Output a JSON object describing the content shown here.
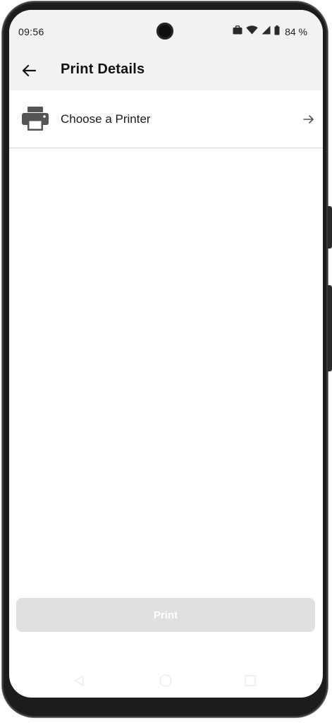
{
  "status_bar": {
    "time": "09:56",
    "icons": [
      "briefcase-icon",
      "wifi-icon",
      "signal-icon",
      "battery-icon"
    ],
    "battery_percent": "84 %"
  },
  "app_bar": {
    "back_icon": "arrow-left-icon",
    "title": "Print Details"
  },
  "printer_selector": {
    "icon": "printer-icon",
    "label": "Choose a Printer",
    "trailing_icon": "arrow-right-icon"
  },
  "actions": {
    "print_label": "Print",
    "print_enabled": false
  },
  "nav_bar": {
    "items": [
      "back-nav-icon",
      "home-nav-icon",
      "recents-nav-icon"
    ]
  },
  "colors": {
    "app_bar_bg": "#f2f2f2",
    "divider": "#d4d4d4",
    "icon_gray": "#555555",
    "button_disabled_bg": "#e0e0e0",
    "button_disabled_text": "#ffffff"
  }
}
